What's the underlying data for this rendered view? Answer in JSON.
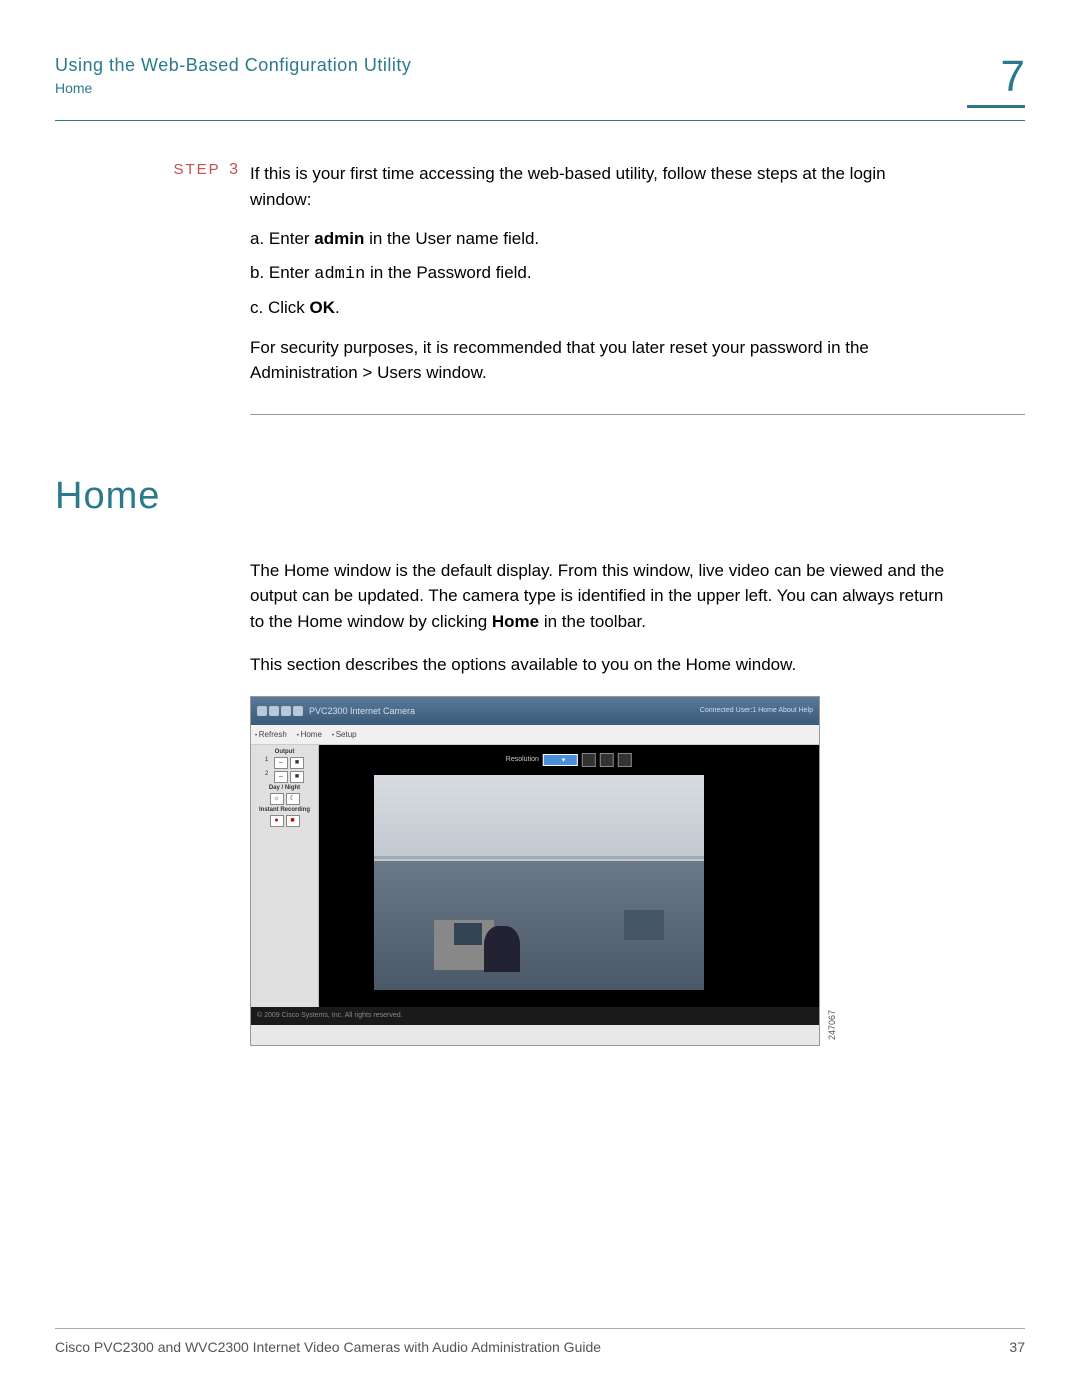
{
  "header": {
    "chapter_title": "Using the Web-Based Configuration Utility",
    "breadcrumb": "Home",
    "chapter_number": "7"
  },
  "step": {
    "label": "STEP",
    "number": "3",
    "intro": "If this is your first time accessing the web-based utility, follow these steps at the login window:",
    "items": {
      "a_marker": "a.",
      "a_pre": "Enter ",
      "a_bold": "admin",
      "a_post": " in the User name field.",
      "b_marker": "b.",
      "b_pre": "Enter ",
      "b_mono": "admin",
      "b_post": " in the Password field.",
      "c_marker": "c.",
      "c_pre": "Click ",
      "c_bold": "OK",
      "c_post": "."
    },
    "note": "For security purposes, it is recommended that you later reset your password in the Administration > Users window."
  },
  "section": {
    "heading": "Home",
    "p1_pre": "The Home window is the default display. From this window, live video can be viewed and the output can be updated. The camera type is identified in the upper left. You can always return to the Home window by clicking ",
    "p1_bold": "Home",
    "p1_post": " in the toolbar.",
    "p2": "This section describes the options available to you on the Home window."
  },
  "figure": {
    "brand_sub": "PVC2300 Internet Camera",
    "top_links": "Connected User:1   Home   About   Help",
    "tabs": {
      "refresh": "Refresh",
      "home": "Home",
      "setup": "Setup"
    },
    "side": {
      "output_label": "Output",
      "row1_num": "1",
      "row2_num": "2",
      "daynight_label": "Day / Night",
      "instant_label": "Instant Recording"
    },
    "resolution_label": "Resolution",
    "copyright": "© 2009 Cisco Systems, Inc. All rights reserved.",
    "image_id": "247067"
  },
  "footer": {
    "doc_title": "Cisco PVC2300 and WVC2300 Internet Video Cameras with Audio Administration Guide",
    "page_num": "37"
  }
}
